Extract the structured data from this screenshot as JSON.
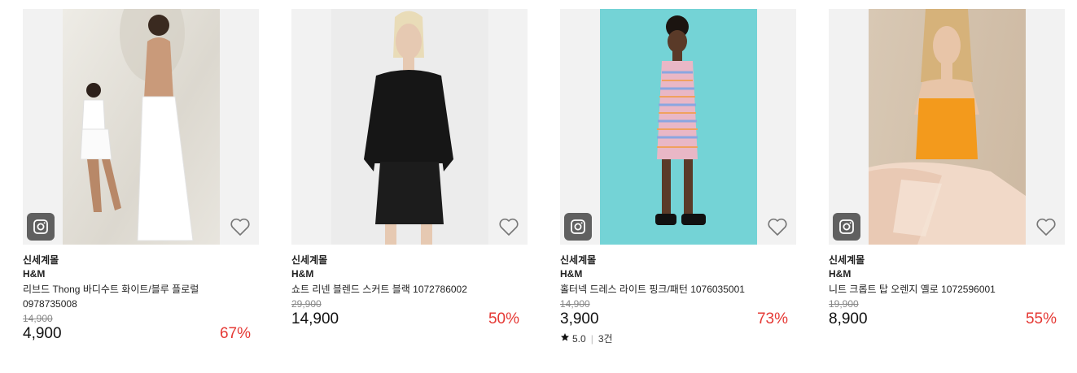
{
  "products": [
    {
      "store": "신세계몰",
      "brand": "H&M",
      "title_line1": "리브드 Thong 바디수트 화이트/블루 플로럴",
      "title_line2": "0978735008",
      "original_price": "14,900",
      "price": "4,900",
      "discount": "67%",
      "has_badge": true,
      "photo_bg": "#e9e6df"
    },
    {
      "store": "신세계몰",
      "brand": "H&M",
      "title_line1": "쇼트 리넨 블렌드 스커트 블랙 1072786002",
      "original_price": "29,900",
      "price": "14,900",
      "discount": "50%",
      "has_badge": false,
      "photo_bg": "#ededed"
    },
    {
      "store": "신세계몰",
      "brand": "H&M",
      "title_line1": "홀터넥 드레스 라이트 핑크/패턴 1076035001",
      "original_price": "14,900",
      "price": "3,900",
      "discount": "73%",
      "has_badge": true,
      "photo_bg": "#74d3d6",
      "rating": "5.0",
      "review_count": "3건"
    },
    {
      "store": "신세계몰",
      "brand": "H&M",
      "title_line1": "니트 크롭트 탑 오렌지 옐로 1072596001",
      "original_price": "19,900",
      "price": "8,900",
      "discount": "55%",
      "has_badge": true,
      "photo_bg": "#d8c8b4"
    }
  ],
  "colors": {
    "discount": "#e53935",
    "card_bg": "#f2f2f2",
    "badge_bg": "#464646"
  },
  "icons": {
    "badge": "instagram-icon",
    "wishlist": "heart-outline-icon",
    "rating": "star-icon"
  }
}
